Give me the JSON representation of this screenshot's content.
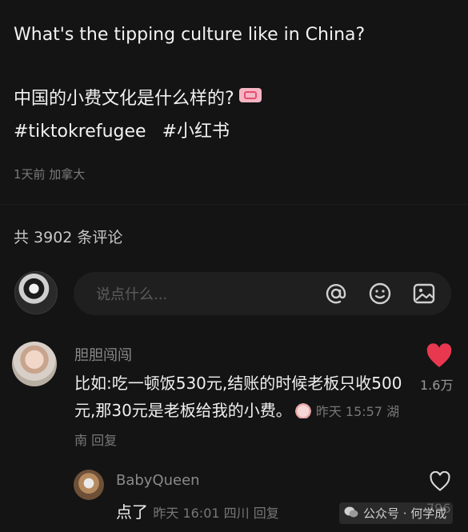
{
  "post": {
    "title_en": "What's the tipping culture like in China?",
    "title_zh": "中国的小费文化是什么样的?",
    "tags": [
      "#tiktokrefugee",
      "#小红书"
    ],
    "meta": "1天前 加拿大"
  },
  "comments_header": {
    "count_label": "共 3902 条评论"
  },
  "composer": {
    "placeholder": "说点什么..."
  },
  "comments": [
    {
      "username": "胆胆闯闯",
      "text": "比如:吃一顿饭530元,结账的时候老板只收500元,那30元是老板给我的小费。",
      "meta": "昨天 15:57 湖南 回复",
      "likes": "1.6万",
      "liked": true
    },
    {
      "username": "BabyQueen",
      "text": "点了",
      "meta": "昨天 16:01 四川 回复",
      "likes": "796",
      "liked": false
    }
  ],
  "watermark": {
    "text": "公众号 · 何学成"
  },
  "colors": {
    "background": "#141414",
    "like_red": "#e8384f",
    "muted": "#7a7a7a"
  },
  "icons": [
    "at-icon",
    "emoji-icon",
    "image-icon",
    "heart-icon",
    "heart-outline-icon",
    "wechat-icon"
  ]
}
